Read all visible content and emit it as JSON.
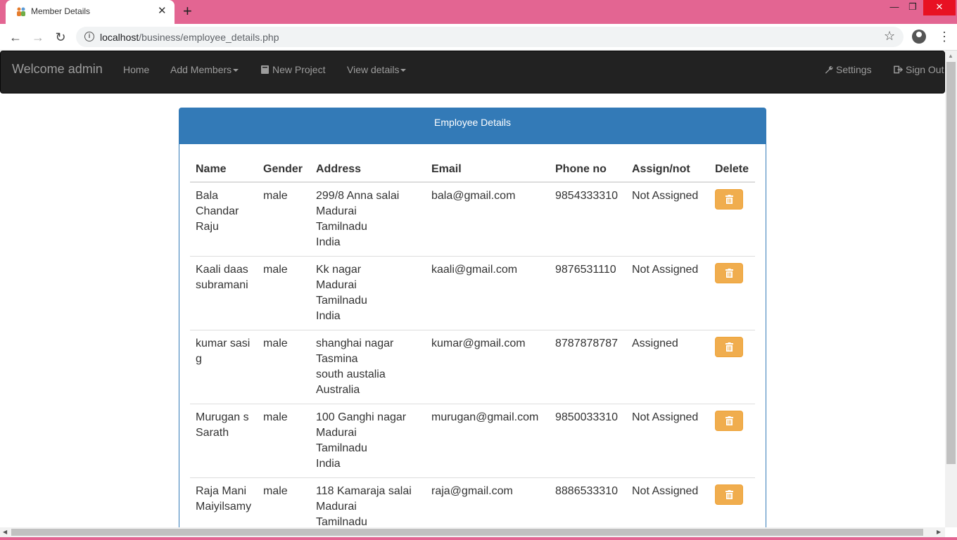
{
  "browser": {
    "tab_title": "Member Details",
    "tab_close": "✕",
    "new_tab": "+",
    "url_host": "localhost",
    "url_path": "/business/employee_details.php",
    "window_controls": [
      "—",
      "❐",
      "✕"
    ]
  },
  "navbar": {
    "brand": "Welcome admin",
    "home": "Home",
    "add_members": "Add Members",
    "new_project": "New Project",
    "view_details": "View details",
    "settings": "Settings",
    "sign_out": "Sign Out"
  },
  "panel": {
    "heading": "Employee Details"
  },
  "table": {
    "headers": [
      "Name",
      "Gender",
      "Address",
      "Email",
      "Phone no",
      "Assign/not",
      "Delete"
    ],
    "rows": [
      {
        "name": [
          "Bala",
          "Chandar",
          "Raju"
        ],
        "gender": "male",
        "address": [
          "299/8 Anna salai",
          "Madurai",
          "Tamilnadu",
          "India"
        ],
        "email": "bala@gmail.com",
        "phone": "9854333310",
        "assign": "Not Assigned"
      },
      {
        "name": [
          "Kaali daas",
          "subramani"
        ],
        "gender": "male",
        "address": [
          "Kk nagar",
          "Madurai",
          "Tamilnadu",
          "India"
        ],
        "email": "kaali@gmail.com",
        "phone": "9876531110",
        "assign": "Not Assigned"
      },
      {
        "name": [
          "kumar sasi",
          "g"
        ],
        "gender": "male",
        "address": [
          "shanghai nagar",
          "Tasmina",
          "south austalia",
          "Australia"
        ],
        "email": "kumar@gmail.com",
        "phone": "8787878787",
        "assign": "Assigned"
      },
      {
        "name": [
          "Murugan s",
          "Sarath"
        ],
        "gender": "male",
        "address": [
          "100 Ganghi nagar",
          "Madurai",
          "Tamilnadu",
          "India"
        ],
        "email": "murugan@gmail.com",
        "phone": "9850033310",
        "assign": "Not Assigned"
      },
      {
        "name": [
          "Raja Mani",
          "Maiyilsamy"
        ],
        "gender": "male",
        "address": [
          "118 Kamaraja salai",
          "Madurai",
          "Tamilnadu"
        ],
        "email": "raja@gmail.com",
        "phone": "8886533310",
        "assign": "Not Assigned"
      }
    ]
  },
  "colors": {
    "tabbar": "#e36592",
    "navbar": "#222222",
    "panel_heading": "#337ab7",
    "delete_button": "#f0ad4e"
  }
}
